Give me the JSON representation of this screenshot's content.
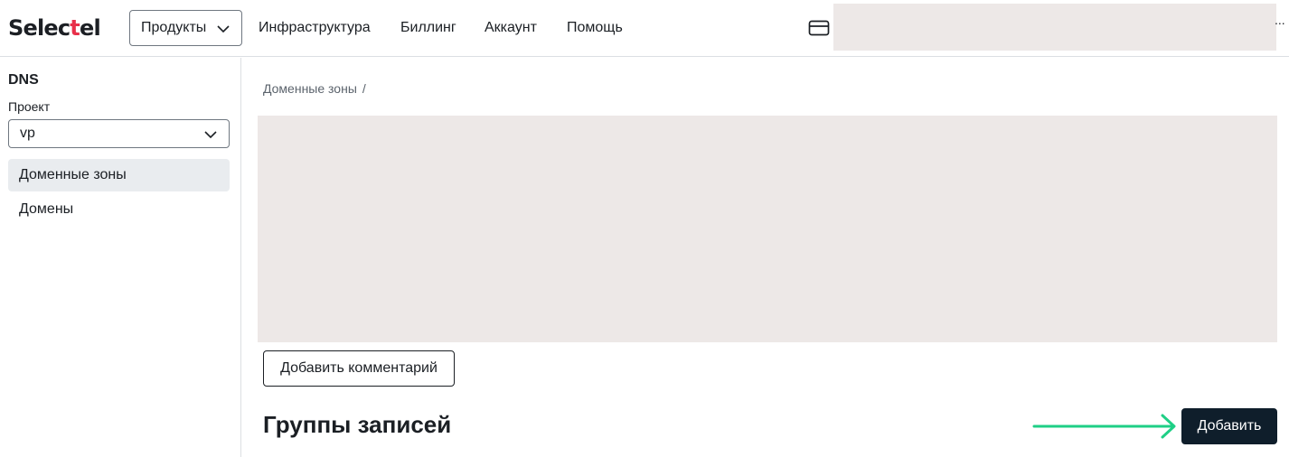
{
  "header": {
    "logo_pre": "Selec",
    "logo_accent": "t",
    "logo_post": "el",
    "products_label": "Продукты",
    "nav": [
      "Инфраструктура",
      "Биллинг",
      "Аккаунт",
      "Помощь"
    ],
    "overflow_label": "..."
  },
  "sidebar": {
    "title": "DNS",
    "project_label": "Проект",
    "project_value": "vp",
    "items": [
      {
        "label": "Доменные зоны",
        "active": true
      },
      {
        "label": "Домены",
        "active": false
      }
    ]
  },
  "main": {
    "breadcrumb": {
      "item": "Доменные зоны",
      "separator": "/"
    },
    "add_comment_label": "Добавить комментарий",
    "section_title": "Группы записей",
    "add_button_label": "Добавить"
  },
  "colors": {
    "brand_accent": "#e8304a",
    "primary_button": "#0f1e2b",
    "annotation_arrow": "#1fcf86",
    "redaction": "#ede8e7",
    "active_item_bg": "#e9ecef"
  },
  "icons": [
    "card-icon",
    "chevron-down-icon",
    "arrow-right-icon"
  ]
}
